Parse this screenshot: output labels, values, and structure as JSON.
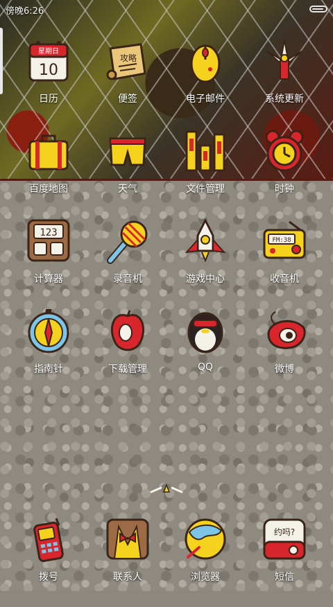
{
  "status_bar": {
    "time": "傍晚6:26",
    "battery_level": 0.9
  },
  "page_indicator": {
    "pages": 3,
    "current_page": 2
  },
  "apps": [
    {
      "label": "日历",
      "icon": "calendar-icon",
      "calendar_header": "星期日",
      "calendar_day": "10"
    },
    {
      "label": "便签",
      "icon": "notes-scroll-icon",
      "scroll_text": "攻略"
    },
    {
      "label": "电子邮件",
      "icon": "email-mouse-icon"
    },
    {
      "label": "系统更新",
      "icon": "system-update-icon"
    },
    {
      "label": "百度地图",
      "icon": "suitcase-map-icon"
    },
    {
      "label": "天气",
      "icon": "weather-shorts-icon"
    },
    {
      "label": "文件管理",
      "icon": "file-manager-icon"
    },
    {
      "label": "时钟",
      "icon": "alarm-clock-icon"
    },
    {
      "label": "计算器",
      "icon": "calculator-icon",
      "display_text": "123"
    },
    {
      "label": "录音机",
      "icon": "microphone-icon"
    },
    {
      "label": "游戏中心",
      "icon": "rocket-icon"
    },
    {
      "label": "收音机",
      "icon": "radio-icon",
      "display_text": "FM:38"
    },
    {
      "label": "指南针",
      "icon": "compass-icon"
    },
    {
      "label": "下载管理",
      "icon": "apple-download-icon"
    },
    {
      "label": "QQ",
      "icon": "penguin-qq-icon"
    },
    {
      "label": "微博",
      "icon": "weibo-eye-icon"
    }
  ],
  "dock": [
    {
      "label": "拨号",
      "icon": "phone-icon"
    },
    {
      "label": "联系人",
      "icon": "contacts-suit-icon"
    },
    {
      "label": "浏览器",
      "icon": "browser-globe-icon"
    },
    {
      "label": "短信",
      "icon": "sms-bubble-icon",
      "bubble_text": "约吗?"
    }
  ],
  "colors": {
    "yellow": "#f5d21e",
    "red": "#d8262c",
    "outline": "#3a2418"
  }
}
